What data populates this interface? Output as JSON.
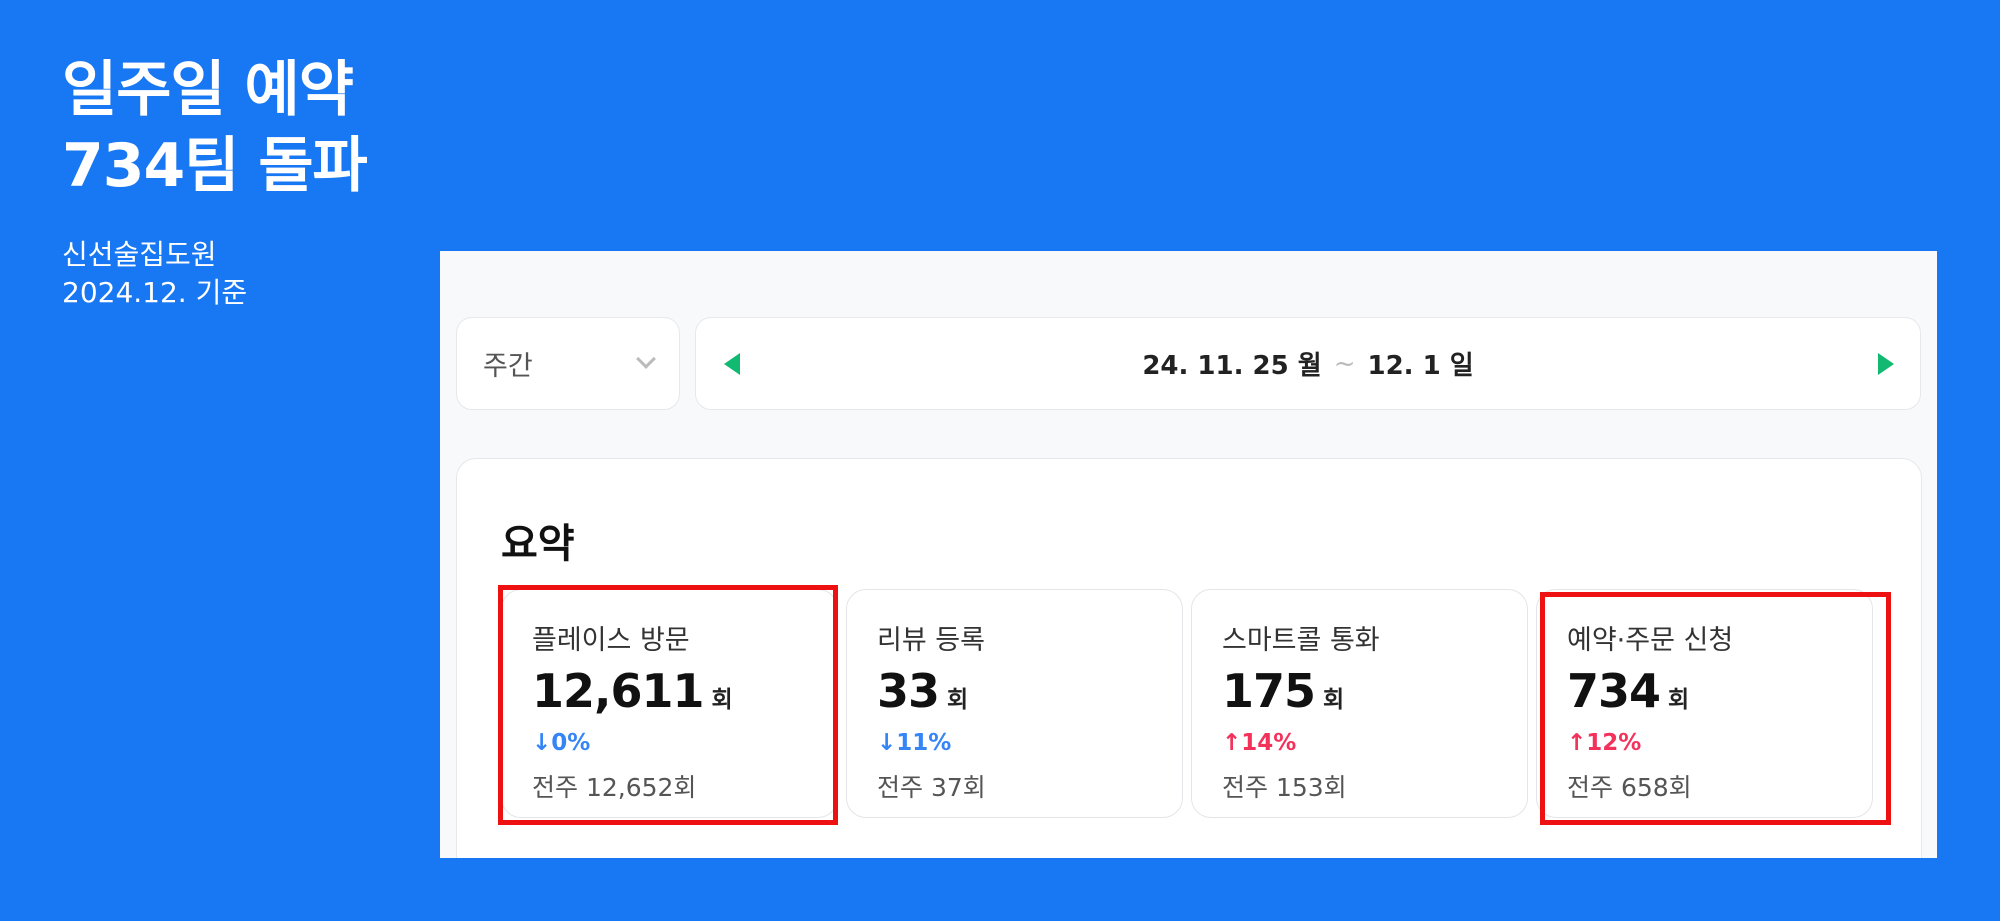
{
  "headline": {
    "line1": "일주일 예약",
    "line2": "734팀 돌파"
  },
  "subline": {
    "line1": "신선술집도원",
    "line2": "2024.12. 기준"
  },
  "period_select": {
    "value": "주간"
  },
  "date_bar": {
    "start": "24. 11. 25 월",
    "separator": "~",
    "end": "12. 1 일"
  },
  "summary": {
    "title": "요약",
    "metrics": [
      {
        "label": "플레이스 방문",
        "value": "12,611",
        "unit": "회",
        "change": "0%",
        "direction": "down",
        "prev": "전주 12,652회"
      },
      {
        "label": "리뷰 등록",
        "value": "33",
        "unit": "회",
        "change": "11%",
        "direction": "down",
        "prev": "전주 37회"
      },
      {
        "label": "스마트콜 통화",
        "value": "175",
        "unit": "회",
        "change": "14%",
        "direction": "up",
        "prev": "전주 153회"
      },
      {
        "label": "예약·주문 신청",
        "value": "734",
        "unit": "회",
        "change": "12%",
        "direction": "up",
        "prev": "전주 658회"
      }
    ]
  },
  "colors": {
    "background": "#1877F2",
    "accent_green": "#12B971",
    "down_blue": "#3585F7",
    "up_red": "#F3325C",
    "highlight_red": "#EE1111"
  },
  "icons": {
    "dropdown": "chevron-down-icon",
    "prev": "triangle-left-icon",
    "next": "triangle-right-icon",
    "down": "arrow-down-icon",
    "up": "arrow-up-icon"
  }
}
